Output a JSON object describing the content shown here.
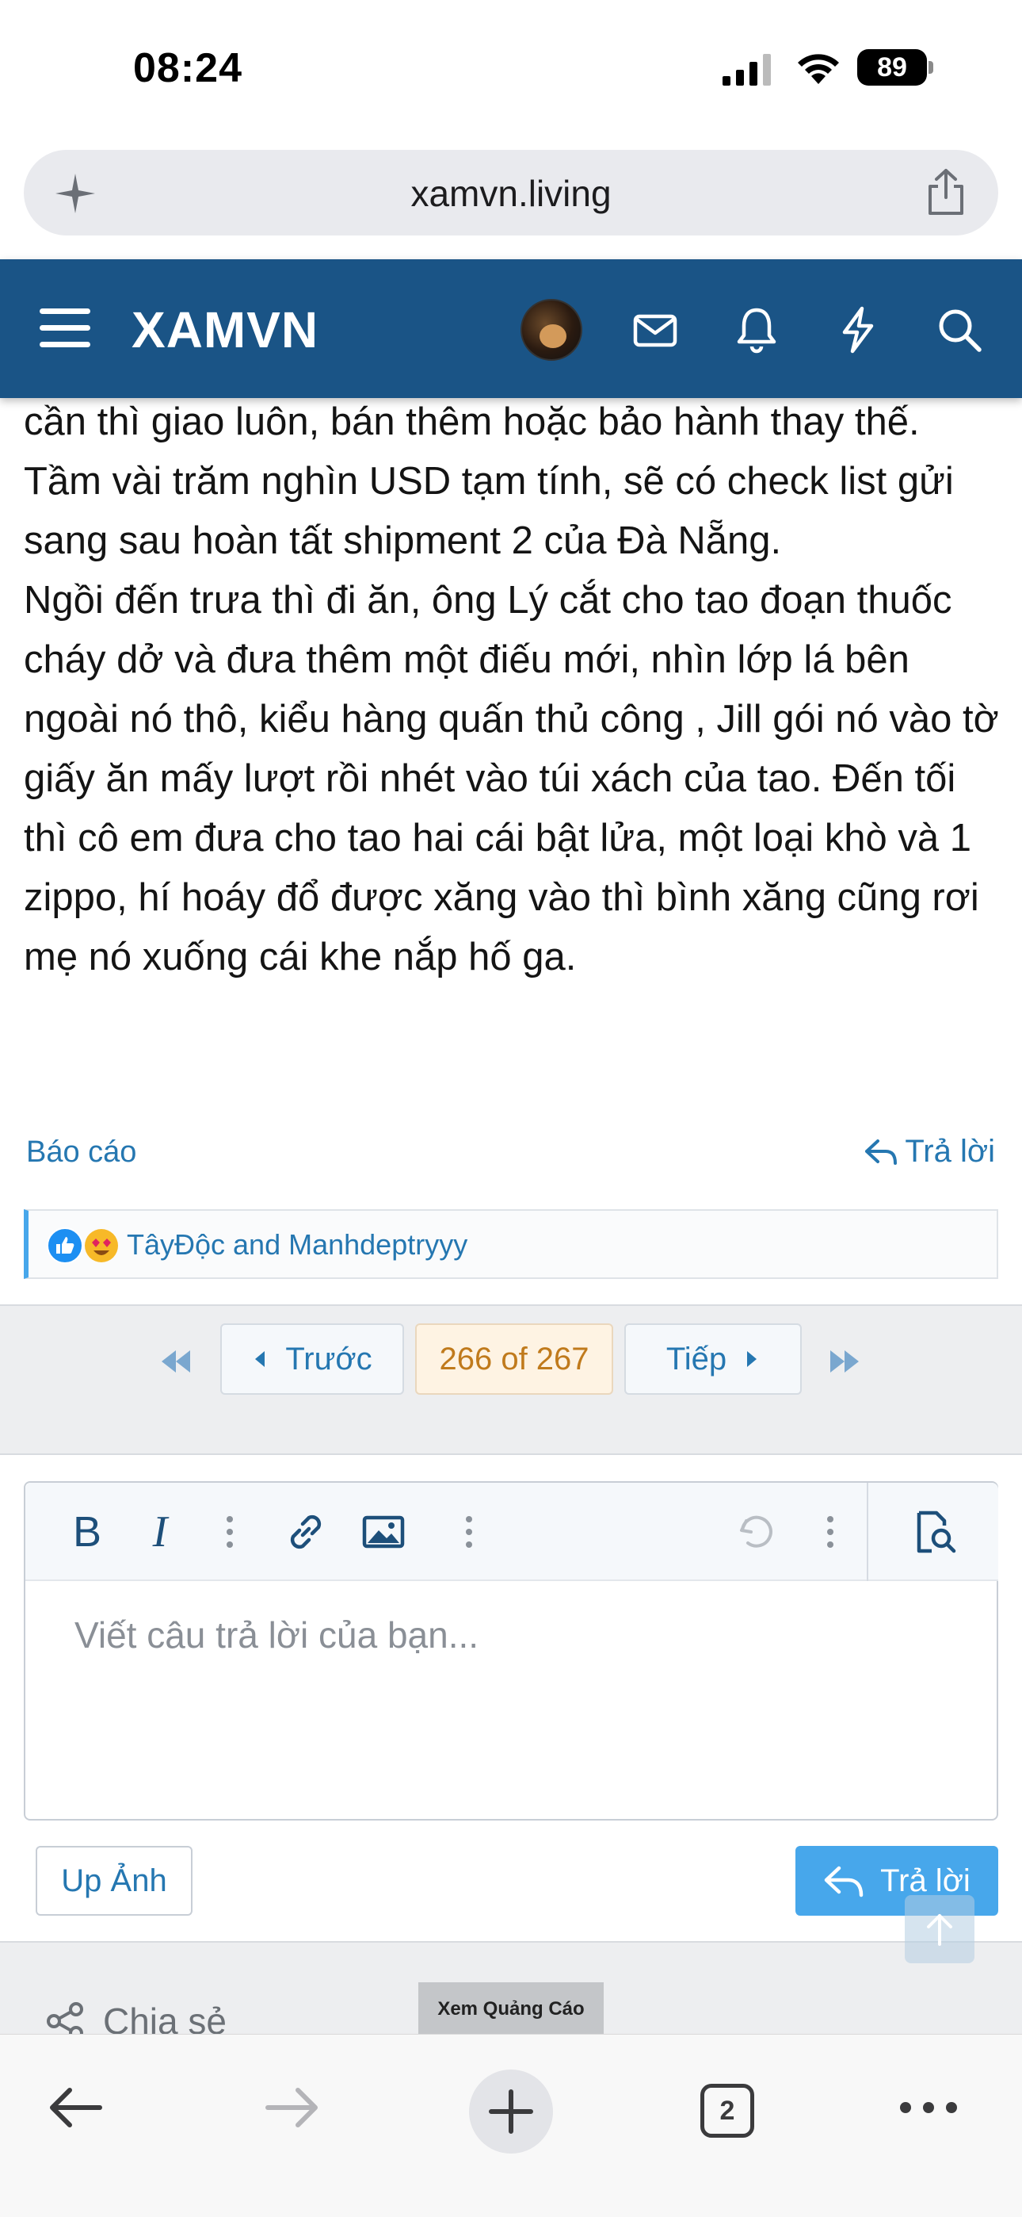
{
  "status_bar": {
    "time": "08:24",
    "battery": "89"
  },
  "browser": {
    "url": "xamvn.living",
    "tab_count": "2"
  },
  "site": {
    "logo": "XAMVN"
  },
  "post": {
    "paragraphs": [
      "cần thì giao luôn, bán thêm hoặc bảo hành thay thế. Tầm vài trăm nghìn USD tạm tính, sẽ có check list gửi sang sau hoàn tất shipment 2 của Đà Nẵng.",
      "Ngồi đến trưa thì đi ăn, ông Lý cắt cho tao đoạn thuốc cháy dở và đưa thêm một điếu mới, nhìn lớp lá bên ngoài nó thô, kiểu hàng quấn thủ công , Jill gói nó vào tờ giấy ăn mấy lượt rồi nhét vào túi xách của tao. Đến tối thì cô em đưa cho tao hai cái bật lửa, một loại khò và 1 zippo, hí hoáy đổ được xăng vào thì bình xăng cũng rơi mẹ nó xuống cái khe nắp hố ga."
    ],
    "report_label": "Báo cáo",
    "reply_label": "Trả lời",
    "reactions_text": "TâyĐộc and Manhdeptryyy"
  },
  "pagination": {
    "prev_label": "Trước",
    "current": "266 of 267",
    "next_label": "Tiếp"
  },
  "editor": {
    "placeholder": "Viết câu trả lời của bạn..."
  },
  "buttons": {
    "upload_label": "Up Ảnh",
    "reply_label": "Trả lời"
  },
  "footer": {
    "share_label": "Chia sẻ",
    "ad_label": "Xem Quảng Cáo"
  },
  "colors": {
    "header": "#1a5486",
    "link": "#2577b1",
    "accent": "#47a7eb"
  }
}
